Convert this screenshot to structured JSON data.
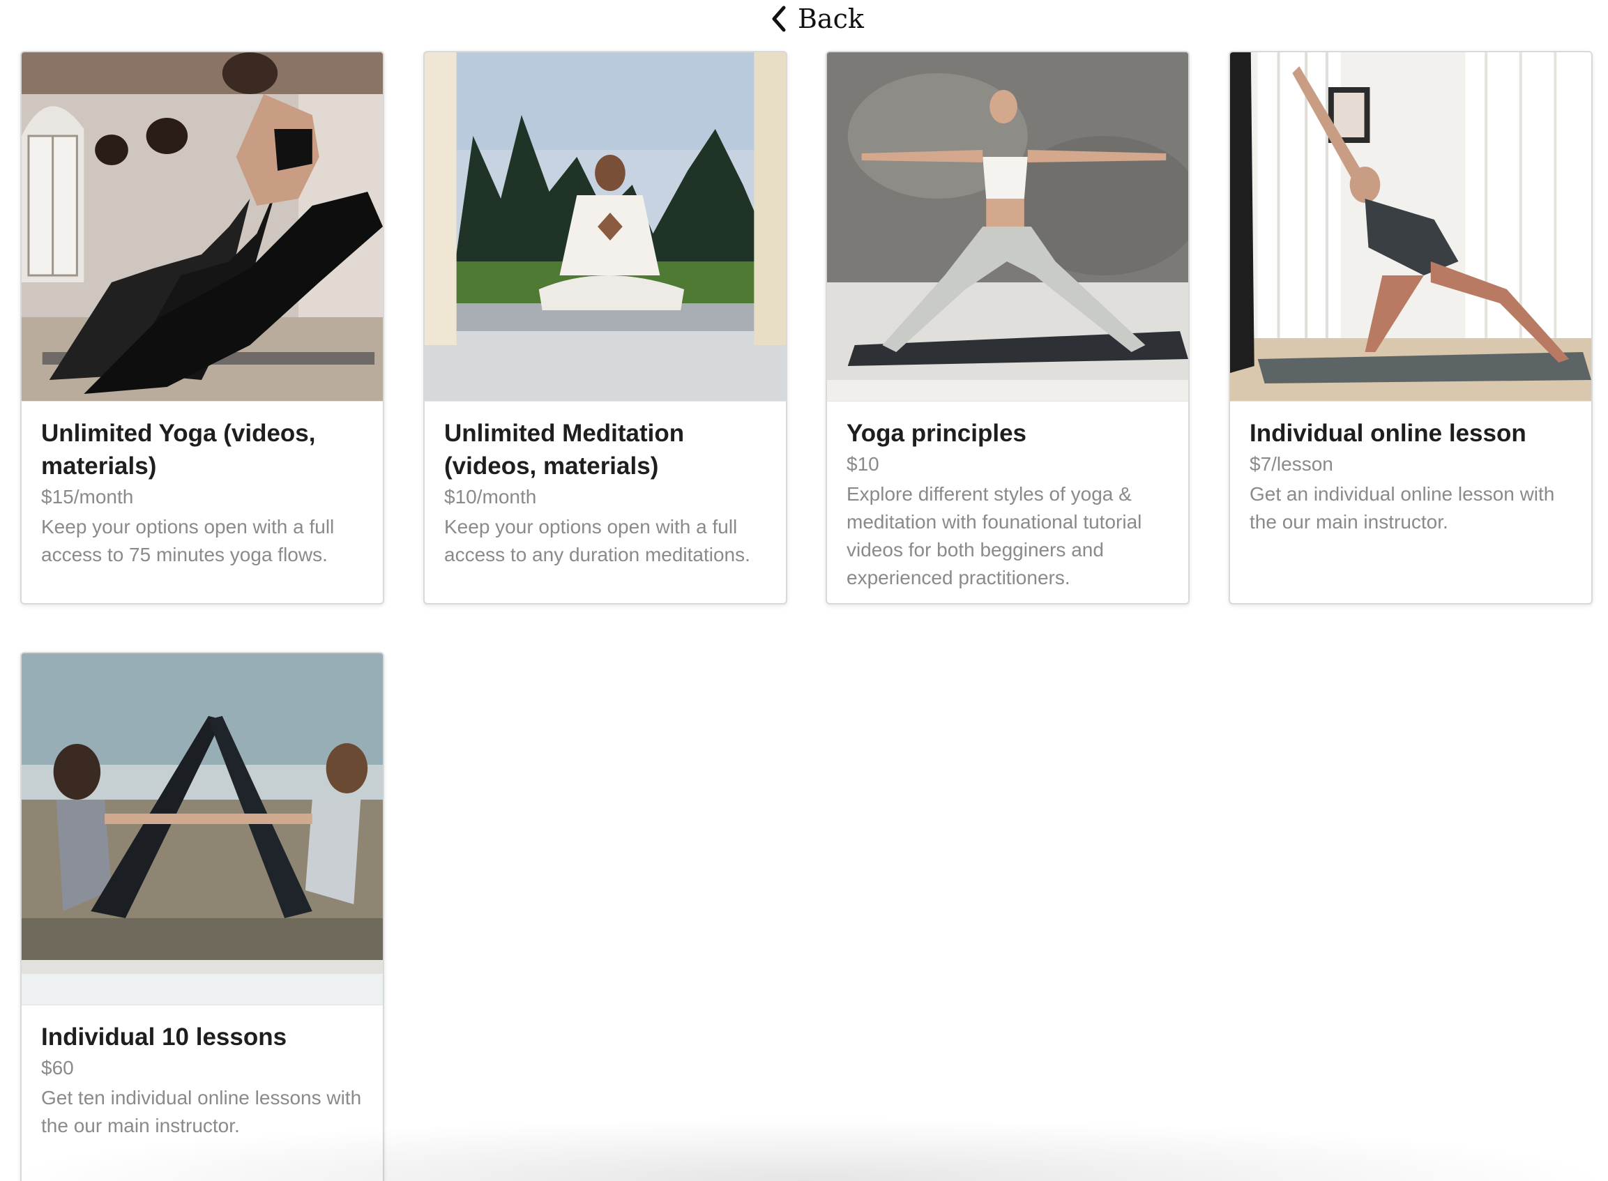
{
  "nav": {
    "back_label": "Back",
    "back_icon": "chevron-left-icon"
  },
  "products": [
    {
      "title": "Unlimited Yoga (videos, materials)",
      "price": "$15/month",
      "description": "Keep your options open with a full access to 75 minutes yoga flows.",
      "image": "yoga-class-photo"
    },
    {
      "title": "Unlimited Meditation (videos, materials)",
      "price": "$10/month",
      "description": "Keep your options open with a full access to any duration meditations.",
      "image": "meditation-photo"
    },
    {
      "title": "Yoga principles",
      "price": "$10",
      "description": "Explore different styles of yoga & meditation with founational tutorial videos for both begginers and experienced practitioners.",
      "image": "warrior-pose-photo"
    },
    {
      "title": "Individual online lesson",
      "price": "$7/lesson",
      "description": "Get an individual online lesson with the our main instructor.",
      "image": "instructor-assist-photo"
    },
    {
      "title": "Individual 10 lessons",
      "price": "$60",
      "description": "Get ten individual online lessons with the our main instructor.",
      "image": "partner-yoga-beach-photo"
    }
  ]
}
